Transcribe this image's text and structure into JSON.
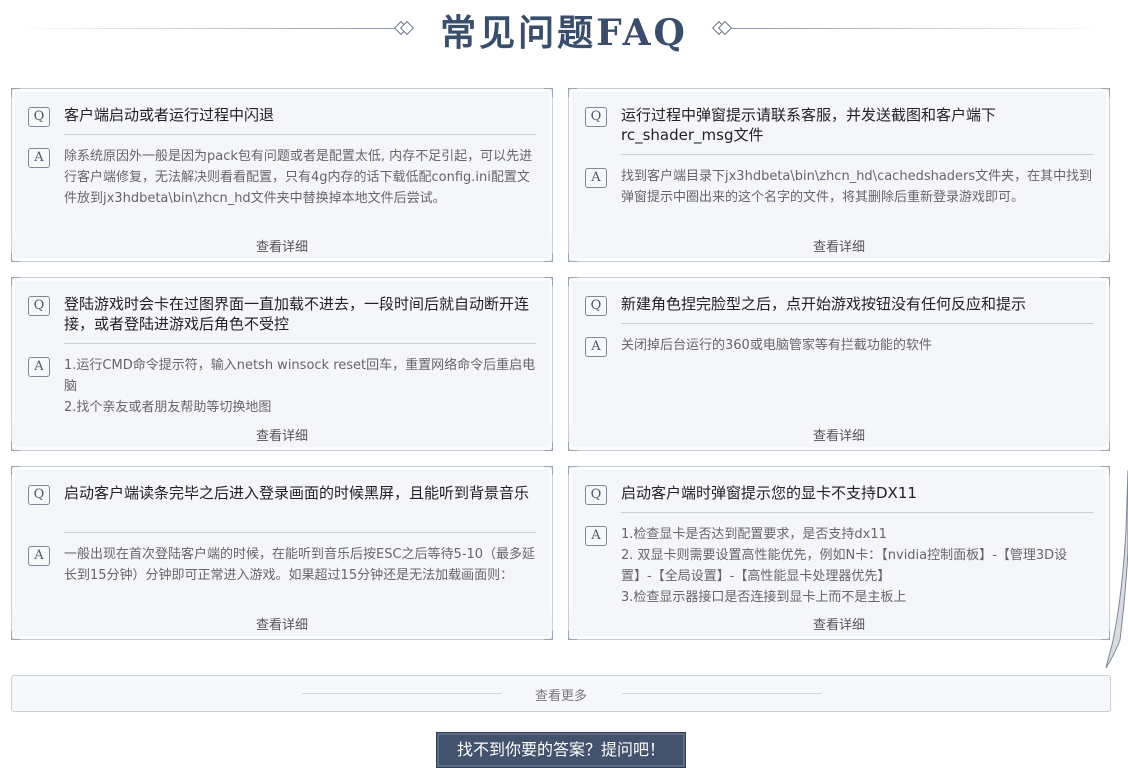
{
  "header": {
    "title": "常见问题FAQ"
  },
  "labels": {
    "q": "Q",
    "a": "A",
    "detail": "查看详细"
  },
  "faqs": [
    {
      "q": "客户端启动或者运行过程中闪退",
      "a": "除系统原因外一般是因为pack包有问题或者是配置太低, 内存不足引起，可以先进行客户端修复，无法解决则看看配置，只有4g内存的话下载低配config.ini配置文件放到jx3hdbeta\\bin\\zhcn_hd文件夹中替换掉本地文件后尝试。"
    },
    {
      "q": "运行过程中弹窗提示请联系客服，并发送截图和客户端下rc_shader_msg文件",
      "a": "找到客户端目录下jx3hdbeta\\bin\\zhcn_hd\\cachedshaders文件夹，在其中找到弹窗提示中圈出来的这个名字的文件，将其删除后重新登录游戏即可。"
    },
    {
      "q": "登陆游戏时会卡在过图界面一直加载不进去，一段时间后就自动断开连接，或者登陆进游戏后角色不受控",
      "a": "1.运行CMD命令提示符，输入netsh winsock reset回车，重置网络命令后重启电脑\n2.找个亲友或者朋友帮助等切换地图"
    },
    {
      "q": "新建角色捏完脸型之后，点开始游戏按钮没有任何反应和提示",
      "a": "关闭掉后台运行的360或电脑管家等有拦截功能的软件"
    },
    {
      "q": "启动客户端读条完毕之后进入登录画面的时候黑屏，且能听到背景音乐",
      "a": "一般出现在首次登陆客户端的时候，在能听到音乐后按ESC之后等待5-10（最多延长到15分钟）分钟即可正常进入游戏。如果超过15分钟还是无法加载画面则："
    },
    {
      "q": "启动客户端时弹窗提示您的显卡不支持DX11",
      "a": "1.检查显卡是否达到配置要求，是否支持dx11\n2. 双显卡则需要设置高性能优先，例如N卡：【nvidia控制面板】-【管理3D设置】-【全局设置】-【高性能显卡处理器优先】\n3.检查显示器接口是否连接到显卡上而不是主板上"
    }
  ],
  "more": {
    "label": "查看更多"
  },
  "ask": {
    "label": "找不到你要的答案？提问吧！"
  }
}
